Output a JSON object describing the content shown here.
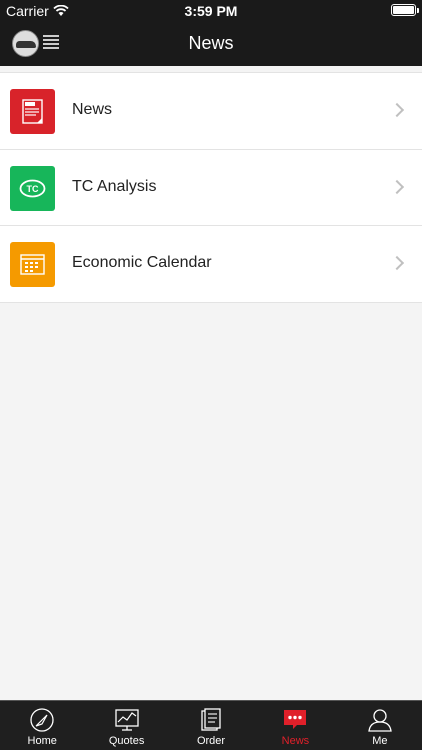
{
  "status_bar": {
    "carrier": "Carrier",
    "time": "3:59 PM"
  },
  "nav": {
    "title": "News"
  },
  "list": [
    {
      "label": "News",
      "icon": "news-icon",
      "color": "#d8232a"
    },
    {
      "label": "TC Analysis",
      "icon": "tc-icon",
      "color": "#17b65a"
    },
    {
      "label": "Economic Calendar",
      "icon": "calendar-icon",
      "color": "#f59a00"
    }
  ],
  "tabs": [
    {
      "label": "Home",
      "icon": "home-compass-icon"
    },
    {
      "label": "Quotes",
      "icon": "quotes-chart-icon"
    },
    {
      "label": "Order",
      "icon": "order-document-icon"
    },
    {
      "label": "News",
      "icon": "news-chat-icon",
      "active": true
    },
    {
      "label": "Me",
      "icon": "profile-icon"
    }
  ],
  "colors": {
    "accent": "#e0202a",
    "bar": "#1a1a1a"
  }
}
